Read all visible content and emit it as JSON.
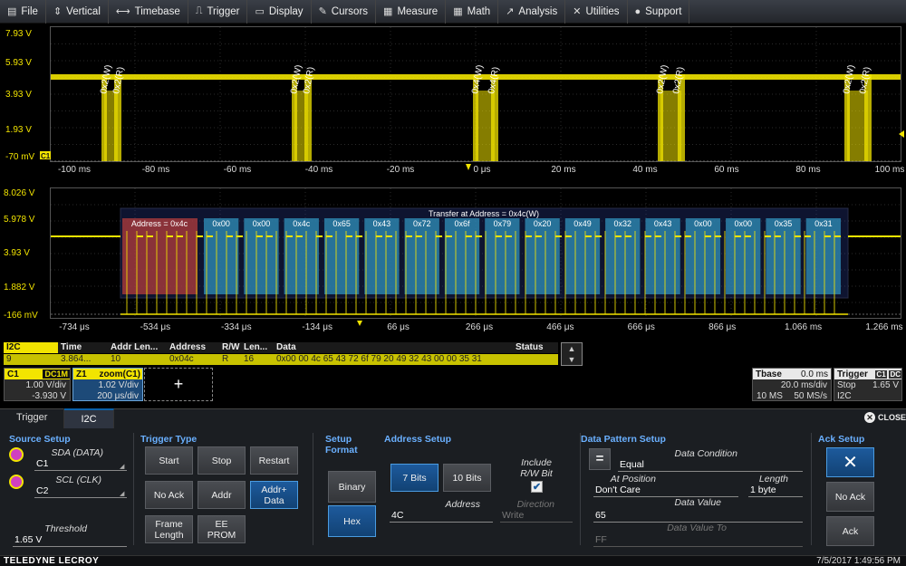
{
  "menu": [
    {
      "icon": "file-icon",
      "glyph": "▤",
      "label": "File"
    },
    {
      "icon": "vertical-icon",
      "glyph": "⇕",
      "label": "Vertical"
    },
    {
      "icon": "timebase-icon",
      "glyph": "⟷",
      "label": "Timebase"
    },
    {
      "icon": "trigger-icon",
      "glyph": "⎍",
      "label": "Trigger"
    },
    {
      "icon": "display-icon",
      "glyph": "▭",
      "label": "Display"
    },
    {
      "icon": "cursors-icon",
      "glyph": "✎",
      "label": "Cursors"
    },
    {
      "icon": "measure-icon",
      "glyph": "▦",
      "label": "Measure"
    },
    {
      "icon": "math-icon",
      "glyph": "▦",
      "label": "Math"
    },
    {
      "icon": "analysis-icon",
      "glyph": "↗",
      "label": "Analysis"
    },
    {
      "icon": "utilities-icon",
      "glyph": "✕",
      "label": "Utilities"
    },
    {
      "icon": "support-icon",
      "glyph": "●",
      "label": "Support"
    }
  ],
  "grid_top": {
    "y_labels": [
      "7.93 V",
      "5.93 V",
      "3.93 V",
      "1.93 V",
      "-70 mV"
    ],
    "x_labels": [
      "-100 ms",
      "-80 ms",
      "-60 ms",
      "-40 ms",
      "-20 ms",
      "0 μs",
      "20 ms",
      "40 ms",
      "60 ms",
      "80 ms",
      "100 ms"
    ],
    "annotations": [
      "0x2(W)",
      "0x2(R)",
      "0x2(W)",
      "0x2(R)",
      "0x4(W)",
      "0x4(R)",
      "0x2(W)",
      "0x2(R)",
      "0x2(W)",
      "0x2(R)"
    ],
    "channel_marker": "C1"
  },
  "grid_bottom": {
    "y_labels": [
      "8.026 V",
      "5.978 V",
      "3.93 V",
      "1.882 V",
      "-166 mV"
    ],
    "x_labels": [
      "-734 μs",
      "-534 μs",
      "-334 μs",
      "-134 μs",
      "66 μs",
      "266 μs",
      "466 μs",
      "666 μs",
      "866 μs",
      "1.066 ms",
      "1.266 ms"
    ],
    "transfer_label": "Transfer at Address = 0x4c(W)",
    "address_label": "Address = 0x4c",
    "bytes": [
      "0x00",
      "0x00",
      "0x4c",
      "0x65",
      "0x43",
      "0x72",
      "0x6f",
      "0x79",
      "0x20",
      "0x49",
      "0x32",
      "0x43",
      "0x00",
      "0x00",
      "0x35",
      "0x31"
    ]
  },
  "decoder_table": {
    "tag": "I2C",
    "headers": [
      "Time",
      "Addr Len...",
      "Address",
      "R/W",
      "Len...",
      "Data",
      "Status"
    ],
    "row": {
      "index": "9",
      "time": "3.864...",
      "addr_len": "10",
      "address": "0x04c",
      "rw": "R",
      "len": "16",
      "data": "0x00 00 4c 65 43 72 6f 79 20 49 32 43 00 00 35 31",
      "status": ""
    }
  },
  "channels": {
    "c1": {
      "name": "C1",
      "coupling": "DC1M",
      "vdiv": "1.00 V/div",
      "offset": "-3.930 V"
    },
    "z1": {
      "name": "Z1",
      "source": "zoom(C1)",
      "vdiv": "1.02 V/div",
      "tdiv": "200 μs/div"
    },
    "add_label": "+"
  },
  "timebase": {
    "title": "Tbase",
    "delay": "0.0 ms",
    "tdiv": "20.0 ms/div",
    "samples": "10 MS",
    "rate": "50 MS/s"
  },
  "trigger": {
    "title": "Trigger",
    "src": "C1",
    "coupling": "DC",
    "mode": "Stop",
    "level": "1.65 V",
    "type": "I2C"
  },
  "panel": {
    "tabs": [
      "Trigger",
      "I2C"
    ],
    "close_label": "CLOSE",
    "source_setup": {
      "title": "Source Setup",
      "sda_label": "SDA (DATA)",
      "sda_value": "C1",
      "scl_label": "SCL (CLK)",
      "scl_value": "C2",
      "threshold_label": "Threshold",
      "threshold_value": "1.65 V"
    },
    "trigger_type": {
      "title": "Trigger Type",
      "buttons": [
        "Start",
        "Stop",
        "Restart",
        "No Ack",
        "Addr",
        "Addr+ Data",
        "Frame Length",
        "EE PROM"
      ]
    },
    "setup_format": {
      "title": "Setup Format",
      "buttons": [
        "Binary",
        "Hex"
      ]
    },
    "address_setup": {
      "title": "Address Setup",
      "bit_buttons": [
        "7 Bits",
        "10 Bits"
      ],
      "include_rw_label": "Include R/W Bit",
      "address_label": "Address",
      "address_value": "4C",
      "direction_label": "Direction",
      "direction_value": "Write"
    },
    "data_pattern": {
      "title": "Data Pattern Setup",
      "condition_label": "Data Condition",
      "condition_value": "Equal",
      "position_label": "At Position",
      "position_value": "Don't Care",
      "length_label": "Length",
      "length_value": "1 byte",
      "value_label": "Data Value",
      "value_value": "65",
      "value_to_label": "Data Value To",
      "value_to_value": "FF"
    },
    "ack_setup": {
      "title": "Ack Setup",
      "buttons": [
        "No Ack",
        "Ack"
      ]
    }
  },
  "statusbar": {
    "brand": "TELEDYNE LECROY",
    "datetime": "7/5/2017 1:49:56 PM"
  },
  "colors": {
    "trace": "#f2e400",
    "address_box": "#b43c3c",
    "data_box": "#2e8ab4",
    "accent": "#4a9be0"
  }
}
